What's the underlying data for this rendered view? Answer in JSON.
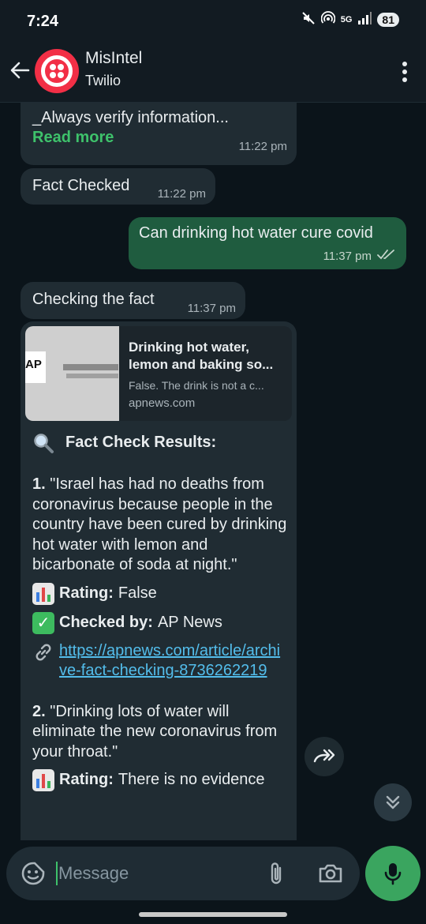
{
  "status": {
    "time": "7:24",
    "network": "5G",
    "battery": "81"
  },
  "header": {
    "contact_name": "MisIntel",
    "contact_sub": "Twilio",
    "brand_color": "#f22f46"
  },
  "messages": {
    "m1": {
      "text": "_Always verify information...",
      "read_more": "Read more",
      "time": "11:22 pm"
    },
    "m2": {
      "text": "Fact Checked",
      "time": "11:22 pm"
    },
    "m3": {
      "text": "Can drinking hot water cure covid",
      "time": "11:37 pm",
      "status": "read"
    },
    "m4": {
      "text": "Checking the fact",
      "time": "11:37 pm"
    },
    "m5": {
      "preview": {
        "title": "Drinking hot water, lemon and baking so...",
        "description": "False. The drink is not a c...",
        "domain": "apnews.com"
      },
      "heading": "Fact Check Results:",
      "claim1": {
        "number": "1.",
        "text": "\"Israel has had no deaths from coronavirus because people in the country have been cured by drinking hot water with lemon and bicarbonate of soda at night.\"",
        "rating_label": "Rating:",
        "rating_value": "False",
        "checked_label": "Checked by:",
        "checked_value": "AP News",
        "link": "https://apnews.com/article/archive-fact-checking-8736262219"
      },
      "claim2": {
        "number": "2.",
        "text": "\"Drinking lots of water will eliminate the new coronavirus from your throat.\"",
        "rating_label": "Rating:",
        "rating_value": "There is no evidence"
      }
    }
  },
  "composer": {
    "placeholder": "Message"
  },
  "colors": {
    "accent": "#3ec26b",
    "link": "#53bdeb",
    "incoming_bubble": "#202c33",
    "outgoing_bubble": "#1f5c3f"
  }
}
